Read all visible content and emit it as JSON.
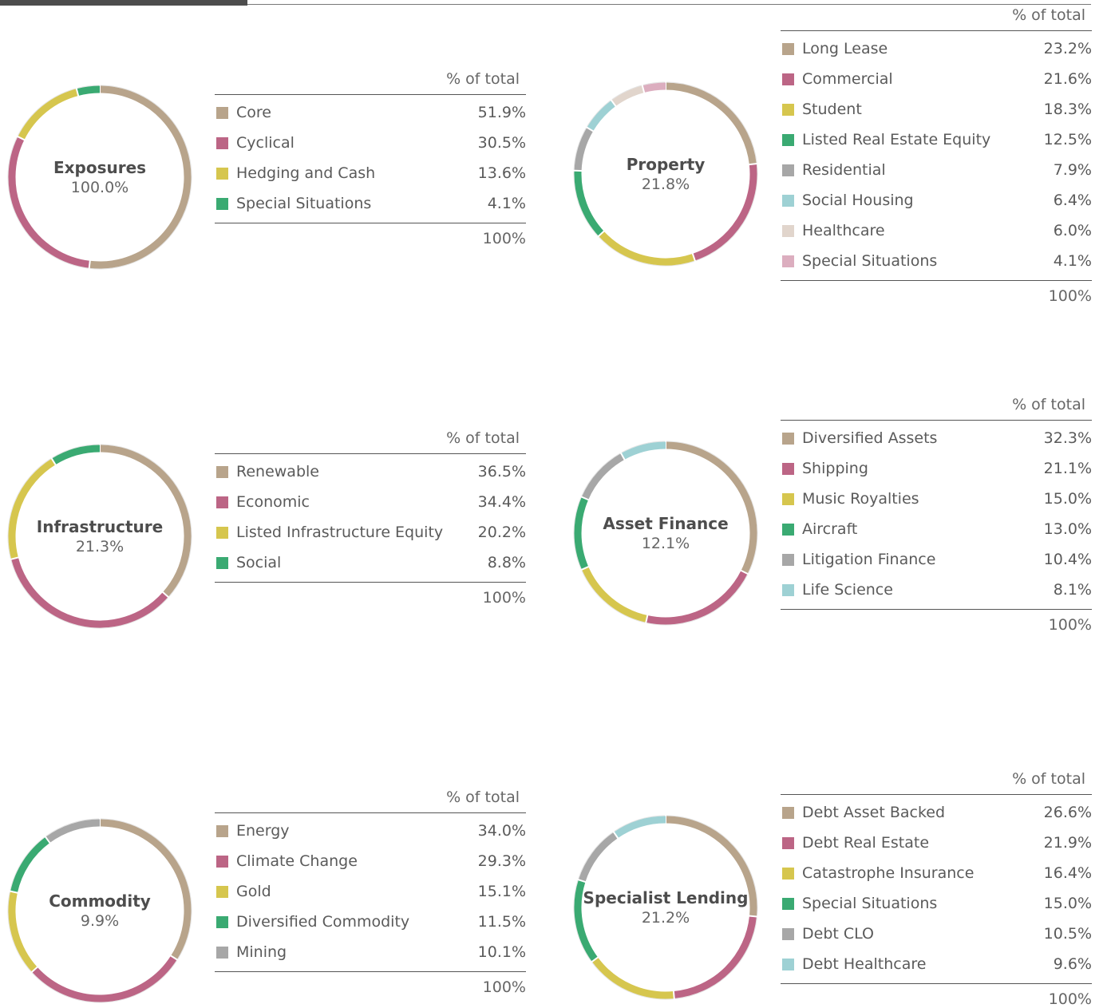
{
  "header_label": "% of total",
  "total_label": "100%",
  "colors": {
    "tan": "#b8a48b",
    "rose": "#bc6585",
    "yellow": "#d6c64e",
    "green": "#3aaa72",
    "grey": "#a7a7a7",
    "lightblue": "#9ed1d4",
    "beige": "#e1d5cc",
    "pink": "#dcaebf"
  },
  "chart_data": [
    {
      "type": "pie",
      "title": "Exposures",
      "total": "100.0%",
      "series": [
        {
          "name": "Core",
          "value": 51.9,
          "label": "51.9%",
          "color": "#b8a48b"
        },
        {
          "name": "Cyclical",
          "value": 30.5,
          "label": "30.5%",
          "color": "#bc6585"
        },
        {
          "name": "Hedging and Cash",
          "value": 13.6,
          "label": "13.6%",
          "color": "#d6c64e"
        },
        {
          "name": "Special Situations",
          "value": 4.1,
          "label": "4.1%",
          "color": "#3aaa72"
        }
      ]
    },
    {
      "type": "pie",
      "title": "Property",
      "total": "21.8%",
      "series": [
        {
          "name": "Long Lease",
          "value": 23.2,
          "label": "23.2%",
          "color": "#b8a48b"
        },
        {
          "name": "Commercial",
          "value": 21.6,
          "label": "21.6%",
          "color": "#bc6585"
        },
        {
          "name": "Student",
          "value": 18.3,
          "label": "18.3%",
          "color": "#d6c64e"
        },
        {
          "name": "Listed Real Estate Equity",
          "value": 12.5,
          "label": "12.5%",
          "color": "#3aaa72"
        },
        {
          "name": "Residential",
          "value": 7.9,
          "label": "7.9%",
          "color": "#a7a7a7"
        },
        {
          "name": "Social Housing",
          "value": 6.4,
          "label": "6.4%",
          "color": "#9ed1d4"
        },
        {
          "name": "Healthcare",
          "value": 6.0,
          "label": "6.0%",
          "color": "#e1d5cc"
        },
        {
          "name": "Special Situations",
          "value": 4.1,
          "label": "4.1%",
          "color": "#dcaebf"
        }
      ]
    },
    {
      "type": "pie",
      "title": "Infrastructure",
      "total": "21.3%",
      "series": [
        {
          "name": "Renewable",
          "value": 36.5,
          "label": "36.5%",
          "color": "#b8a48b"
        },
        {
          "name": "Economic",
          "value": 34.4,
          "label": "34.4%",
          "color": "#bc6585"
        },
        {
          "name": "Listed Infrastructure Equity",
          "value": 20.2,
          "label": "20.2%",
          "color": "#d6c64e"
        },
        {
          "name": "Social",
          "value": 8.8,
          "label": "8.8%",
          "color": "#3aaa72"
        }
      ]
    },
    {
      "type": "pie",
      "title": "Asset Finance",
      "total": "12.1%",
      "series": [
        {
          "name": "Diversified Assets",
          "value": 32.3,
          "label": "32.3%",
          "color": "#b8a48b"
        },
        {
          "name": "Shipping",
          "value": 21.1,
          "label": "21.1%",
          "color": "#bc6585"
        },
        {
          "name": "Music Royalties",
          "value": 15.0,
          "label": "15.0%",
          "color": "#d6c64e"
        },
        {
          "name": "Aircraft",
          "value": 13.0,
          "label": "13.0%",
          "color": "#3aaa72"
        },
        {
          "name": "Litigation Finance",
          "value": 10.4,
          "label": "10.4%",
          "color": "#a7a7a7"
        },
        {
          "name": "Life Science",
          "value": 8.1,
          "label": "8.1%",
          "color": "#9ed1d4"
        }
      ]
    },
    {
      "type": "pie",
      "title": "Commodity",
      "total": "9.9%",
      "series": [
        {
          "name": "Energy",
          "value": 34.0,
          "label": "34.0%",
          "color": "#b8a48b"
        },
        {
          "name": "Climate Change",
          "value": 29.3,
          "label": "29.3%",
          "color": "#bc6585"
        },
        {
          "name": "Gold",
          "value": 15.1,
          "label": "15.1%",
          "color": "#d6c64e"
        },
        {
          "name": "Diversified Commodity",
          "value": 11.5,
          "label": "11.5%",
          "color": "#3aaa72"
        },
        {
          "name": "Mining",
          "value": 10.1,
          "label": "10.1%",
          "color": "#a7a7a7"
        }
      ]
    },
    {
      "type": "pie",
      "title": "Specialist Lending",
      "total": "21.2%",
      "series": [
        {
          "name": "Debt Asset Backed",
          "value": 26.6,
          "label": "26.6%",
          "color": "#b8a48b"
        },
        {
          "name": "Debt Real Estate",
          "value": 21.9,
          "label": "21.9%",
          "color": "#bc6585"
        },
        {
          "name": "Catastrophe Insurance",
          "value": 16.4,
          "label": "16.4%",
          "color": "#d6c64e"
        },
        {
          "name": "Special Situations",
          "value": 15.0,
          "label": "15.0%",
          "color": "#3aaa72"
        },
        {
          "name": "Debt CLO",
          "value": 10.5,
          "label": "10.5%",
          "color": "#a7a7a7"
        },
        {
          "name": "Debt Healthcare",
          "value": 9.6,
          "label": "9.6%",
          "color": "#9ed1d4"
        }
      ]
    }
  ]
}
